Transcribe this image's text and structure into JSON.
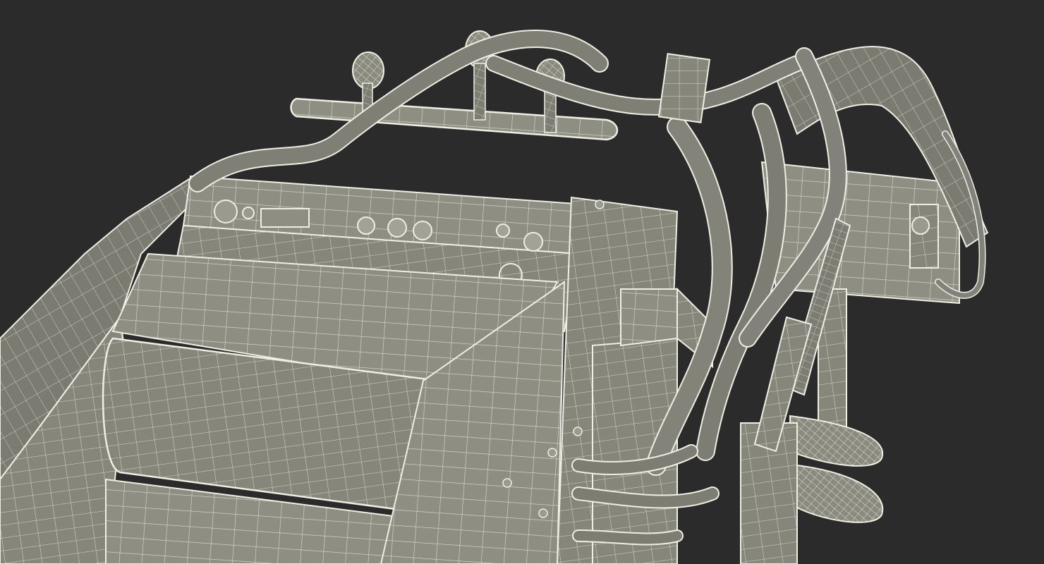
{
  "image": {
    "subject": "wireframe-render",
    "colors": {
      "background": "#2b2b2b",
      "surface": "#8a8a7f",
      "surface_dark": "#6f6f66",
      "surface_light": "#9a9a8e",
      "wire": "#eeeee4"
    }
  }
}
